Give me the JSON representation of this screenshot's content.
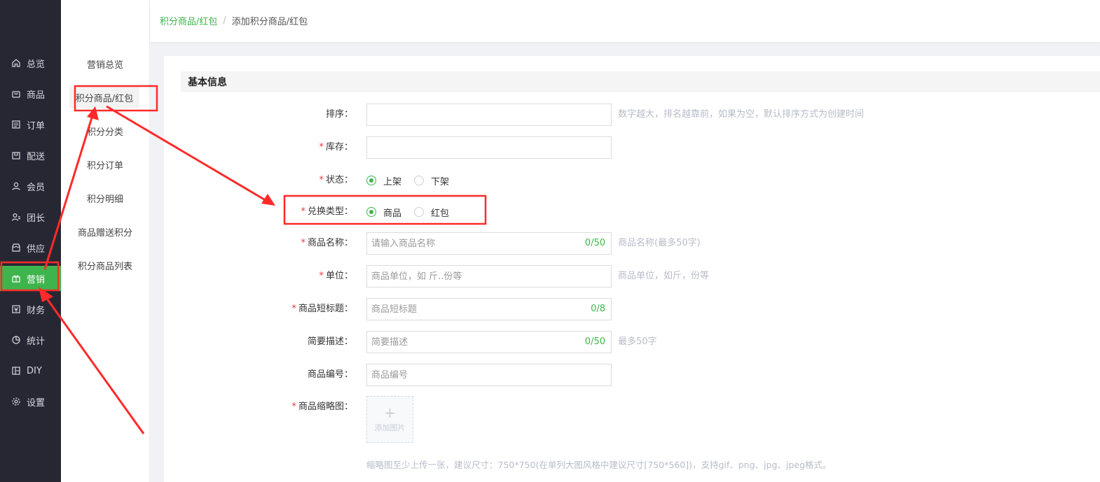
{
  "nav": {
    "items": [
      {
        "label": "总览",
        "icon": "home-icon"
      },
      {
        "label": "商品",
        "icon": "bag-icon"
      },
      {
        "label": "订单",
        "icon": "order-icon"
      },
      {
        "label": "配送",
        "icon": "delivery-icon"
      },
      {
        "label": "会员",
        "icon": "user-icon"
      },
      {
        "label": "团长",
        "icon": "leader-icon"
      },
      {
        "label": "供应",
        "icon": "store-icon"
      },
      {
        "label": "营销",
        "icon": "gift-icon"
      },
      {
        "label": "财务",
        "icon": "finance-icon"
      },
      {
        "label": "统计",
        "icon": "chart-icon"
      },
      {
        "label": "DIY",
        "icon": "layout-icon"
      },
      {
        "label": "设置",
        "icon": "gear-icon"
      }
    ],
    "active": "营销"
  },
  "submenu": {
    "items": [
      "营销总览",
      "积分商品/红包",
      "积分分类",
      "积分订单",
      "积分明细",
      "商品赠送积分",
      "积分商品列表"
    ],
    "active": "积分商品/红包"
  },
  "breadcrumb": {
    "parent": "积分商品/红包",
    "separator": "/",
    "current": "添加积分商品/红包"
  },
  "section": {
    "title": "基本信息"
  },
  "form": {
    "sort": {
      "label": "排序：",
      "value": "",
      "hint": "数字越大，排名越靠前，如果为空，默认排序方式为创建时间"
    },
    "stock": {
      "label": "库存：",
      "value": ""
    },
    "status": {
      "label": "状态：",
      "options": [
        "上架",
        "下架"
      ],
      "selected": "上架"
    },
    "exchange_type": {
      "label": "兑换类型：",
      "options": [
        "商品",
        "红包"
      ],
      "selected": "商品"
    },
    "name": {
      "label": "商品名称：",
      "placeholder": "请输入商品名称",
      "count": "0/50",
      "hint": "商品名称(最多50字)"
    },
    "unit": {
      "label": "单位：",
      "placeholder": "商品单位，如 斤..份等",
      "hint": "商品单位，如斤，份等"
    },
    "short_title": {
      "label": "商品短标题：",
      "placeholder": "商品短标题",
      "count": "0/8"
    },
    "brief": {
      "label": "简要描述：",
      "placeholder": "简要描述",
      "count": "0/50",
      "hint": "最多50字"
    },
    "code": {
      "label": "商品编号：",
      "placeholder": "商品编号"
    },
    "thumbnail": {
      "label": "商品缩略图：",
      "upload_text": "添加图片",
      "upload_symbol": "+"
    },
    "thumbnail_tip": "缩略图至少上传一张，建议尺寸：750*750(在单列大图风格中建议尺寸[750*560])，支持gif、png、jpg、jpeg格式。"
  },
  "colors": {
    "brand_green": "#3eb54c",
    "nav_bg": "#262733",
    "annotation_red": "#ff2a2a"
  }
}
